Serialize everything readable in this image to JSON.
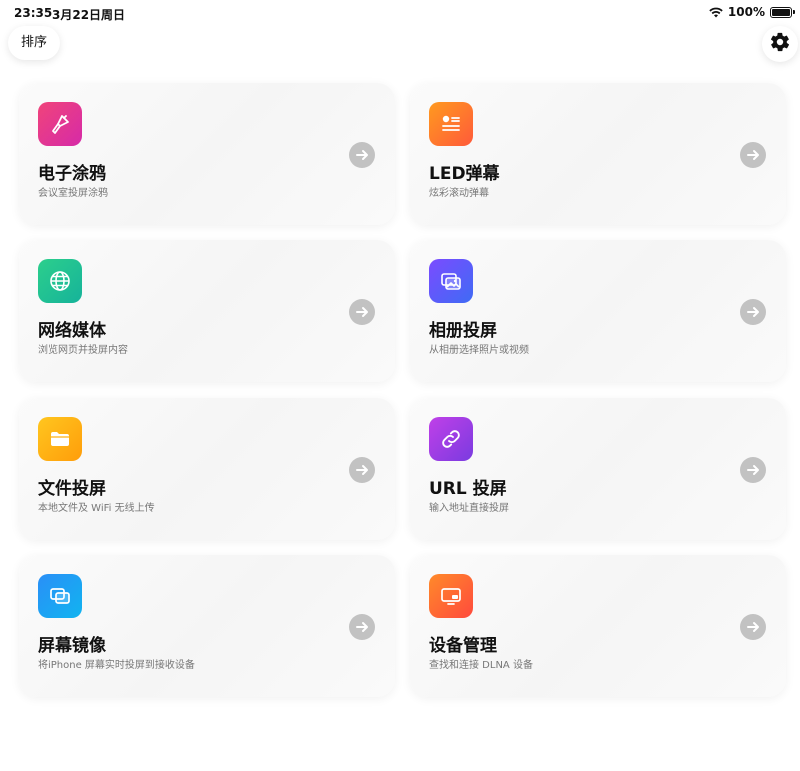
{
  "status_bar": {
    "time": "23:35",
    "date": "3月22日周日",
    "battery": "100%"
  },
  "header": {
    "sort_label": "排序",
    "settings_icon": "gear-icon"
  },
  "cards": [
    {
      "title": "电子涂鸦",
      "subtitle": "会议室投屏涂鸦",
      "icon": "paintbrush-icon",
      "color": "#e83a8e"
    },
    {
      "title": "LED弹幕",
      "subtitle": "炫彩滚动弹幕",
      "icon": "led-marquee-icon",
      "color": "#ff7a2a"
    },
    {
      "title": "网络媒体",
      "subtitle": "浏览网页并投屏内容",
      "icon": "globe-icon",
      "color": "#22c28f"
    },
    {
      "title": "相册投屏",
      "subtitle": "从相册选择照片或视频",
      "icon": "photos-icon",
      "color": "#5a5cf8"
    },
    {
      "title": "文件投屏",
      "subtitle": "本地文件及 WiFi 无线上传",
      "icon": "folder-icon",
      "color": "#ffb214"
    },
    {
      "title": "URL 投屏",
      "subtitle": "输入地址直接投屏",
      "icon": "link-icon",
      "color": "#a23ee5"
    },
    {
      "title": "屏幕镜像",
      "subtitle": "将iPhone 屏幕实时投屏到接收设备",
      "icon": "screen-mirror-icon",
      "color": "#1fa2f4"
    },
    {
      "title": "设备管理",
      "subtitle": "查找和连接 DLNA 设备",
      "icon": "device-icon",
      "color": "#ff6a33"
    }
  ]
}
